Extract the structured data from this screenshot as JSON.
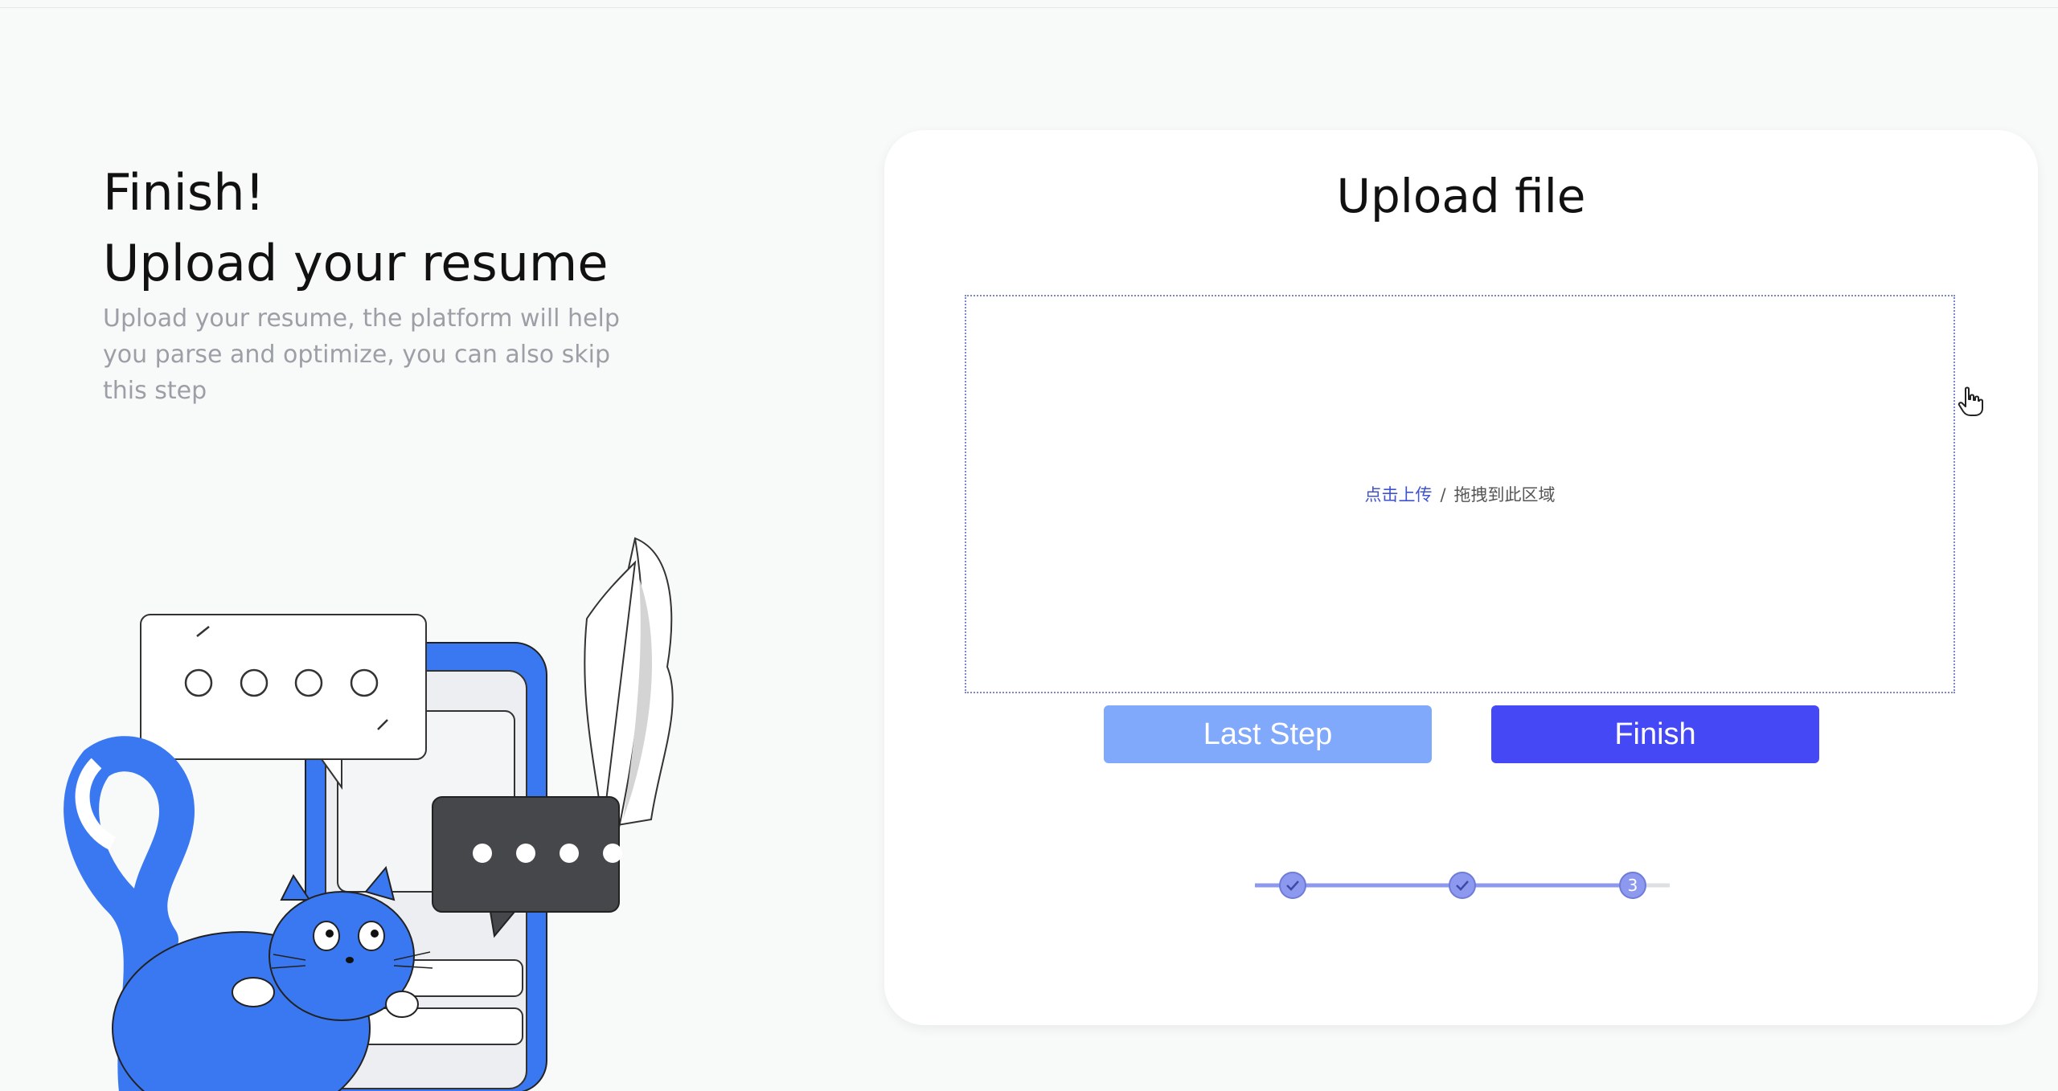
{
  "left": {
    "heading_line1": "Finish!",
    "heading_line2": "Upload your resume",
    "description": "Upload your resume, the platform will help you parse and optimize, you can also skip this step"
  },
  "illustration": {
    "subject": "blue cat with chat bubbles and phone",
    "accent_color": "#3a78f2"
  },
  "upload_card": {
    "title": "Upload file",
    "dropzone": {
      "click_label": "点击上传",
      "separator": "/",
      "drag_label": "拖拽到此区域"
    },
    "buttons": {
      "last_step_label": "Last Step",
      "finish_label": "Finish"
    },
    "stepper": {
      "steps": [
        {
          "state": "done",
          "icon": "check-icon"
        },
        {
          "state": "done",
          "icon": "check-icon"
        },
        {
          "state": "current",
          "label": "3"
        }
      ]
    }
  },
  "colors": {
    "page_bg": "#f8f9f9",
    "primary": "#4549f5",
    "secondary": "#80a8fb",
    "link": "#3f53d0",
    "stepper": "#8c99ef"
  }
}
